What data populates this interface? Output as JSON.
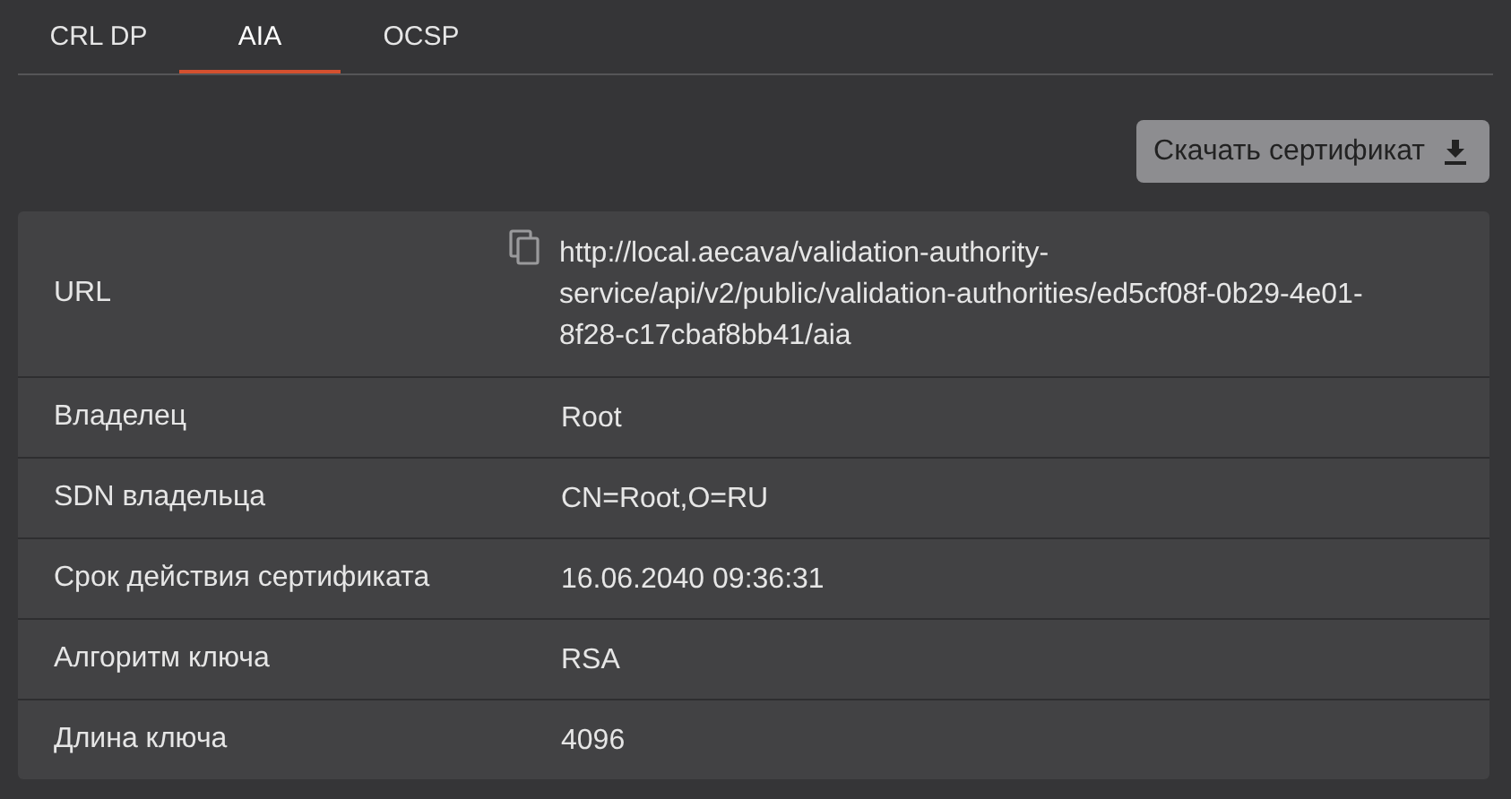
{
  "tabs": [
    {
      "label": "CRL DP",
      "selected": false
    },
    {
      "label": "AIA",
      "selected": true
    },
    {
      "label": "OCSP",
      "selected": false
    }
  ],
  "download_button": {
    "label": "Скачать сертификат"
  },
  "details": [
    {
      "label": "URL",
      "value": "http://local.aecava/validation-authority-service/api/v2/public/validation-authorities/ed5cf08f-0b29-4e01-8f28-c17cbaf8bb41/aia",
      "kind": "copyable"
    },
    {
      "label": "Владелец",
      "value": "Root",
      "kind": "text"
    },
    {
      "label": "SDN владельца",
      "value": "CN=Root,O=RU",
      "kind": "text"
    },
    {
      "label": "Срок действия сертификата",
      "value": "16.06.2040 09:36:31",
      "kind": "text"
    },
    {
      "label": "Алгоритм ключа",
      "value": "RSA",
      "kind": "text"
    },
    {
      "label": "Длина ключа",
      "value": "4096",
      "kind": "text"
    }
  ]
}
